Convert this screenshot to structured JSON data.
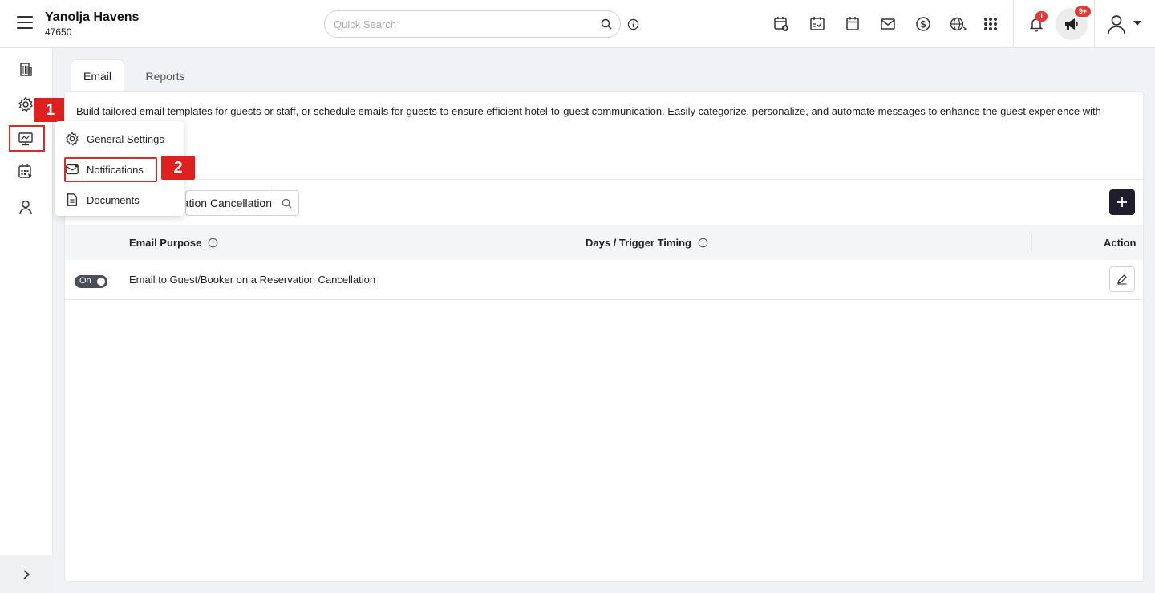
{
  "header": {
    "hotel_name": "Yanolja Havens",
    "hotel_id": "47650",
    "search_placeholder": "Quick Search",
    "notification_badge": "1",
    "announcement_badge": "9+"
  },
  "sidebar": {
    "items": [
      "building-icon",
      "gear-icon",
      "monitor-settings-icon",
      "calendar-grid-icon",
      "user-icon"
    ]
  },
  "annotations": {
    "step1": "1",
    "step2": "2"
  },
  "menu": {
    "items": [
      {
        "label": "General Settings",
        "icon": "gear-icon"
      },
      {
        "label": "Notifications",
        "icon": "mail-notification-icon"
      },
      {
        "label": "Documents",
        "icon": "document-icon"
      }
    ]
  },
  "tabs": [
    {
      "label": "Email",
      "active": true
    },
    {
      "label": "Reports",
      "active": false
    }
  ],
  "main": {
    "description": "Build tailored email templates for guests or staff, or schedule emails for guests to ensure efficient hotel-to-guest communication. Easily categorize, personalize, and automate messages to enhance the guest experience with",
    "filter_value": "Email to Guest/Booker on a Reservation Cancellation",
    "columns": {
      "purpose": "Email Purpose",
      "timing": "Days / Trigger Timing",
      "action": "Action"
    },
    "rows": [
      {
        "toggle": "On",
        "purpose": "Email to Guest/Booker on a Reservation Cancellation",
        "timing": ""
      }
    ]
  },
  "colors": {
    "accent": "#1e1e2d",
    "highlight": "#d32f2f",
    "badge": "#e53935"
  }
}
